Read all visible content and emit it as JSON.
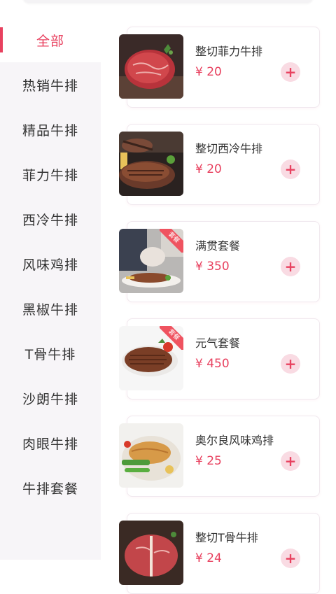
{
  "sidebar": {
    "items": [
      {
        "label": "全部"
      },
      {
        "label": "热销牛排"
      },
      {
        "label": "精品牛排"
      },
      {
        "label": "菲力牛排"
      },
      {
        "label": "西冷牛排"
      },
      {
        "label": "风味鸡排"
      },
      {
        "label": "黑椒牛排"
      },
      {
        "label": "T骨牛排"
      },
      {
        "label": "沙朗牛排"
      },
      {
        "label": "肉眼牛排"
      },
      {
        "label": "牛排套餐"
      }
    ]
  },
  "products": [
    {
      "name": "整切菲力牛排",
      "price": "¥ 20",
      "image": "raw-steak-image"
    },
    {
      "name": "整切西冷牛排",
      "price": "¥ 20",
      "image": "grilled-steak-image"
    },
    {
      "name": "满贯套餐",
      "price": "¥ 350",
      "image": "steak-meal-image",
      "tag": "套餐"
    },
    {
      "name": "元气套餐",
      "price": "¥ 450",
      "image": "steak-plate-image",
      "tag": "套餐"
    },
    {
      "name": "奥尔良风味鸡排",
      "price": "¥ 25",
      "image": "chicken-steak-image"
    },
    {
      "name": "整切T骨牛排",
      "price": "¥ 24",
      "image": "t-bone-steak-image"
    }
  ],
  "add_icon": "plus-icon",
  "colors": {
    "accent": "#e8415f",
    "sidebar_bg": "#f7f5f8",
    "add_button_bg": "#f9dbe3"
  }
}
